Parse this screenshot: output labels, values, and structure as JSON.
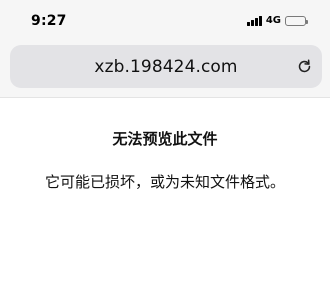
{
  "status_bar": {
    "time": "9:27",
    "network": "4G",
    "signal_bars": 4,
    "battery_level": 0.8
  },
  "address_bar": {
    "url": "xzb.198424.com",
    "reload_icon": "reload-icon"
  },
  "message": {
    "title": "无法预览此文件",
    "body": "它可能已损坏，或为未知文件格式。"
  },
  "colors": {
    "chrome_background": "#f6f6f6",
    "url_field_background": "#e3e3e6",
    "text": "#111111"
  }
}
